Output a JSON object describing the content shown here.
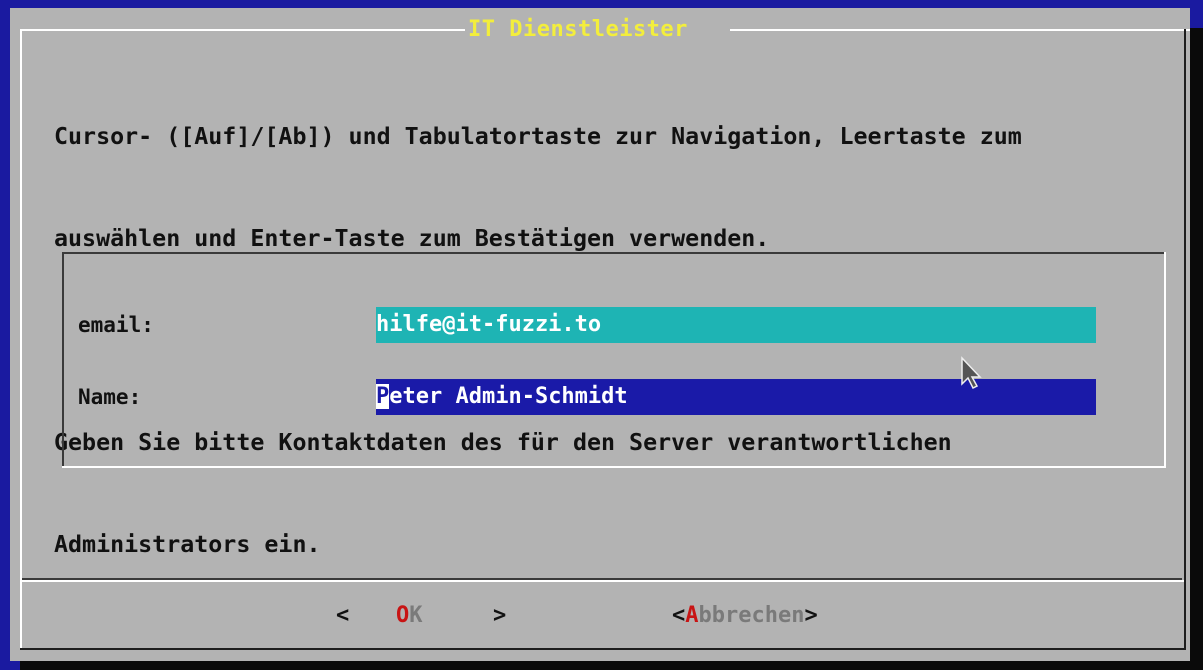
{
  "dialog": {
    "title": "IT Dienstleister",
    "instruction_line1": "Cursor- ([Auf]/[Ab]) und Tabulatortaste zur Navigation, Leertaste zum",
    "instruction_line2": "auswählen und Enter-Taste zum Bestätigen verwenden.",
    "prompt_line1": "Geben Sie bitte Kontaktdaten des für den Server verantwortlichen",
    "prompt_line2": "Administrators ein."
  },
  "form": {
    "email_label": "email:",
    "email_value": "hilfe@it-fuzzi.to",
    "name_label": "Name:",
    "name_cursor_char": "P",
    "name_value_rest": "eter Admin-Schmidt"
  },
  "buttons": {
    "ok": {
      "left_bracket": "<",
      "hotkey": "O",
      "rest": "K",
      "right_bracket": ">"
    },
    "cancel": {
      "left_bracket": "<",
      "hotkey": "A",
      "rest": "bbrechen",
      "right_bracket": ">"
    }
  },
  "colors": {
    "screen_background": "#1a1aa0",
    "dialog_background": "#b3b3b3",
    "title": "#f3ee3c",
    "email_field_background": "#1eb4b4",
    "name_field_background": "#1a1aa8",
    "hotkey": "#c81414"
  },
  "icons": {
    "pointer": "mouse-pointer-icon"
  }
}
